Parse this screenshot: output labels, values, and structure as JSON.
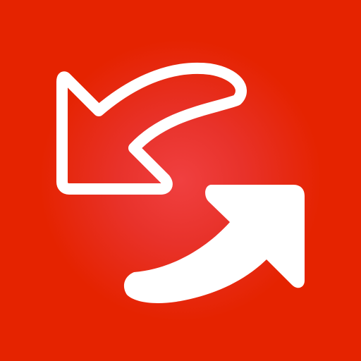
{
  "icon": {
    "name": "swap-arrows-icon",
    "background_color": "#e52300",
    "glow_color": "#f04040",
    "foreground_color": "#ffffff"
  }
}
